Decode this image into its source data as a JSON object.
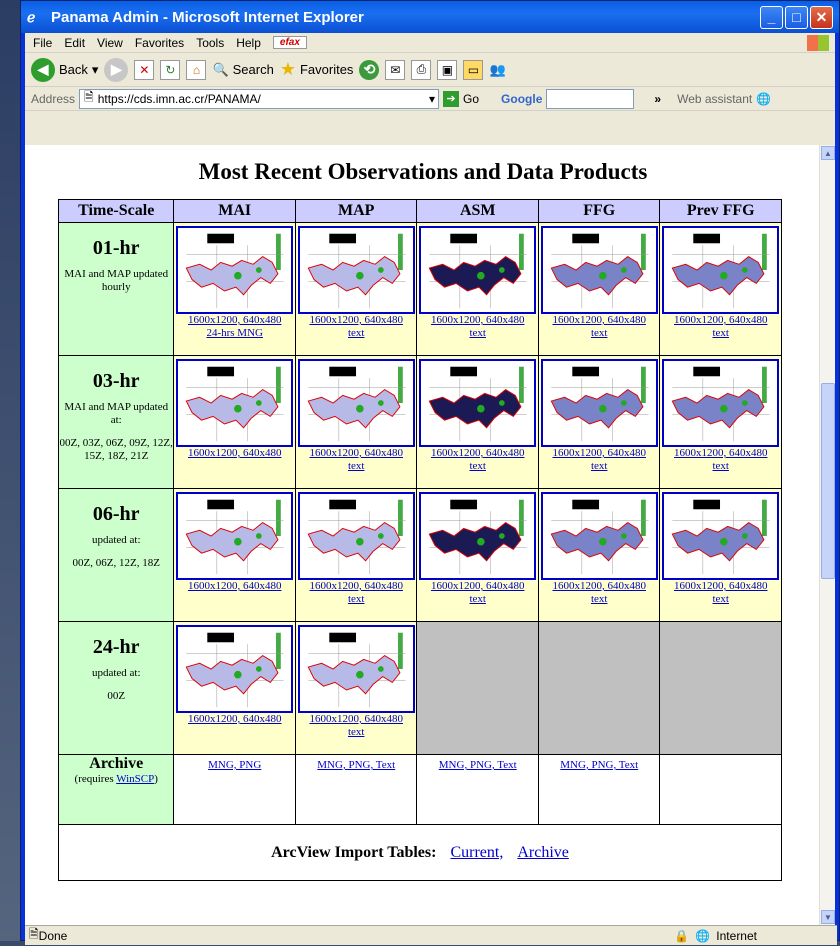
{
  "window": {
    "title": "Panama Admin - Microsoft Internet Explorer",
    "minimize": "_",
    "maximize": "□",
    "close": "✕"
  },
  "menu": [
    "File",
    "Edit",
    "View",
    "Favorites",
    "Tools",
    "Help"
  ],
  "menu_efax": "efax",
  "toolbar": {
    "back": "Back",
    "search": "Search",
    "favorites": "Favorites"
  },
  "address": {
    "label": "Address",
    "url": "https://cds.imn.ac.cr/PANAMA/",
    "go": "Go",
    "google": "Google",
    "assistant": "Web assistant"
  },
  "page": {
    "title": "Most Recent Observations and Data Products",
    "headers": [
      "Time-Scale",
      "MAI",
      "MAP",
      "ASM",
      "FFG",
      "Prev FFG"
    ],
    "rows": [
      {
        "name": "01-hr",
        "note1": "MAI and MAP updated hourly",
        "note2": "",
        "links": [
          [
            "1600x1200, 640x480",
            "24-hrs MNG"
          ],
          [
            "1600x1200, 640x480",
            "text"
          ],
          [
            "1600x1200, 640x480",
            "text"
          ],
          [
            "1600x1200, 640x480",
            "text"
          ],
          [
            "1600x1200, 640x480",
            "text"
          ]
        ]
      },
      {
        "name": "03-hr",
        "note1": "MAI and MAP updated at:",
        "note2": "00Z, 03Z, 06Z, 09Z, 12Z, 15Z, 18Z, 21Z",
        "links": [
          [
            "1600x1200, 640x480",
            ""
          ],
          [
            "1600x1200, 640x480",
            "text"
          ],
          [
            "1600x1200, 640x480",
            "text"
          ],
          [
            "1600x1200, 640x480",
            "text"
          ],
          [
            "1600x1200, 640x480",
            "text"
          ]
        ]
      },
      {
        "name": "06-hr",
        "note1": "updated at:",
        "note2": "00Z, 06Z, 12Z, 18Z",
        "links": [
          [
            "1600x1200, 640x480",
            ""
          ],
          [
            "1600x1200, 640x480",
            "text"
          ],
          [
            "1600x1200, 640x480",
            "text"
          ],
          [
            "1600x1200, 640x480",
            "text"
          ],
          [
            "1600x1200, 640x480",
            "text"
          ]
        ]
      },
      {
        "name": "24-hr",
        "note1": "updated at:",
        "note2": "00Z",
        "links": [
          [
            "1600x1200, 640x480",
            ""
          ],
          [
            "1600x1200, 640x480",
            "text"
          ]
        ]
      }
    ],
    "archive": {
      "name": "Archive",
      "requires": "(requires",
      "winscp": "WinSCP",
      "close_paren": ")",
      "cells": [
        "MNG, PNG",
        "MNG, PNG, Text",
        "MNG, PNG, Text",
        "MNG, PNG, Text",
        ""
      ]
    },
    "import": {
      "label": "ArcView Import Tables:",
      "current": "Current,",
      "archive": "Archive"
    }
  },
  "status": {
    "left": "Done",
    "zone": "Internet"
  }
}
